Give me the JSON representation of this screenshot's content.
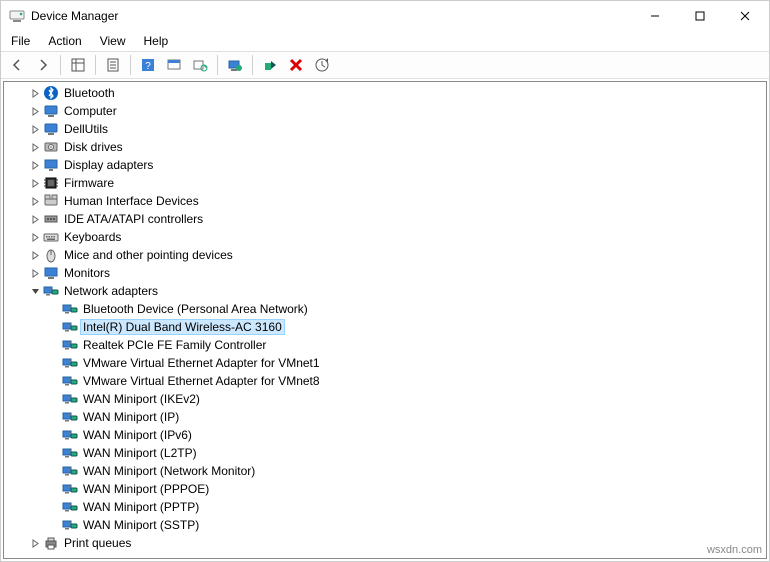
{
  "window": {
    "title": "Device Manager"
  },
  "menu": {
    "file": "File",
    "action": "Action",
    "view": "View",
    "help": "Help"
  },
  "tree": [
    {
      "level": 1,
      "expander": "closed",
      "icon": "bluetooth",
      "label": "Bluetooth",
      "selected": false
    },
    {
      "level": 1,
      "expander": "closed",
      "icon": "computer",
      "label": "Computer",
      "selected": false
    },
    {
      "level": 1,
      "expander": "closed",
      "icon": "computer",
      "label": "DellUtils",
      "selected": false
    },
    {
      "level": 1,
      "expander": "closed",
      "icon": "disk",
      "label": "Disk drives",
      "selected": false
    },
    {
      "level": 1,
      "expander": "closed",
      "icon": "display",
      "label": "Display adapters",
      "selected": false
    },
    {
      "level": 1,
      "expander": "closed",
      "icon": "firmware",
      "label": "Firmware",
      "selected": false
    },
    {
      "level": 1,
      "expander": "closed",
      "icon": "hid",
      "label": "Human Interface Devices",
      "selected": false
    },
    {
      "level": 1,
      "expander": "closed",
      "icon": "ide",
      "label": "IDE ATA/ATAPI controllers",
      "selected": false
    },
    {
      "level": 1,
      "expander": "closed",
      "icon": "keyboard",
      "label": "Keyboards",
      "selected": false
    },
    {
      "level": 1,
      "expander": "closed",
      "icon": "mouse",
      "label": "Mice and other pointing devices",
      "selected": false
    },
    {
      "level": 1,
      "expander": "closed",
      "icon": "monitor",
      "label": "Monitors",
      "selected": false
    },
    {
      "level": 1,
      "expander": "open",
      "icon": "network",
      "label": "Network adapters",
      "selected": false
    },
    {
      "level": 2,
      "expander": "none",
      "icon": "network",
      "label": "Bluetooth Device (Personal Area Network)",
      "selected": false
    },
    {
      "level": 2,
      "expander": "none",
      "icon": "network",
      "label": "Intel(R) Dual Band Wireless-AC 3160",
      "selected": true
    },
    {
      "level": 2,
      "expander": "none",
      "icon": "network",
      "label": "Realtek PCIe FE Family Controller",
      "selected": false
    },
    {
      "level": 2,
      "expander": "none",
      "icon": "network",
      "label": "VMware Virtual Ethernet Adapter for VMnet1",
      "selected": false
    },
    {
      "level": 2,
      "expander": "none",
      "icon": "network",
      "label": "VMware Virtual Ethernet Adapter for VMnet8",
      "selected": false
    },
    {
      "level": 2,
      "expander": "none",
      "icon": "network",
      "label": "WAN Miniport (IKEv2)",
      "selected": false
    },
    {
      "level": 2,
      "expander": "none",
      "icon": "network",
      "label": "WAN Miniport (IP)",
      "selected": false
    },
    {
      "level": 2,
      "expander": "none",
      "icon": "network",
      "label": "WAN Miniport (IPv6)",
      "selected": false
    },
    {
      "level": 2,
      "expander": "none",
      "icon": "network",
      "label": "WAN Miniport (L2TP)",
      "selected": false
    },
    {
      "level": 2,
      "expander": "none",
      "icon": "network",
      "label": "WAN Miniport (Network Monitor)",
      "selected": false
    },
    {
      "level": 2,
      "expander": "none",
      "icon": "network",
      "label": "WAN Miniport (PPPOE)",
      "selected": false
    },
    {
      "level": 2,
      "expander": "none",
      "icon": "network",
      "label": "WAN Miniport (PPTP)",
      "selected": false
    },
    {
      "level": 2,
      "expander": "none",
      "icon": "network",
      "label": "WAN Miniport (SSTP)",
      "selected": false
    },
    {
      "level": 1,
      "expander": "closed",
      "icon": "printer",
      "label": "Print queues",
      "selected": false
    }
  ],
  "watermark": "wsxdn.com"
}
